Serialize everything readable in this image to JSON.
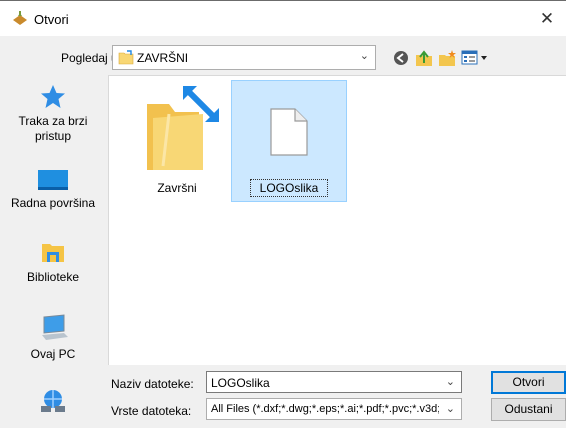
{
  "window": {
    "title": "Otvori",
    "close_glyph": "✕"
  },
  "toolbar": {
    "look_in_label": "Pogledaj u:",
    "look_in_value": "ZAVRŠNI",
    "icons": [
      "back-icon",
      "up-folder-icon",
      "new-folder-icon",
      "view-menu-icon"
    ]
  },
  "places": [
    {
      "label": "Traka za brzi pristup",
      "icon": "quick-access-star-icon"
    },
    {
      "label": "Radna površina",
      "icon": "desktop-icon"
    },
    {
      "label": "Biblioteke",
      "icon": "libraries-icon"
    },
    {
      "label": "Ovaj PC",
      "icon": "this-pc-icon"
    },
    {
      "label": "",
      "icon": "network-icon"
    }
  ],
  "files": [
    {
      "label": "Završni",
      "kind": "folder-shortcut"
    },
    {
      "label": "LOGOslika",
      "kind": "file",
      "selected": true
    }
  ],
  "bottom": {
    "file_name_label": "Naziv datoteke:",
    "file_name_value": "LOGOslika",
    "file_type_label": "Vrste datoteka:",
    "file_type_value": "All Files (*.dxf;*.dwg;*.eps;*.ai;*.pdf;*.pvc;*.v3d;",
    "open_label": "Otvori",
    "cancel_label": "Odustani"
  },
  "colors": {
    "selection": "#cce8ff",
    "selection_border": "#99d1ff",
    "accent": "#0078d7",
    "folder": "#f8d775"
  }
}
